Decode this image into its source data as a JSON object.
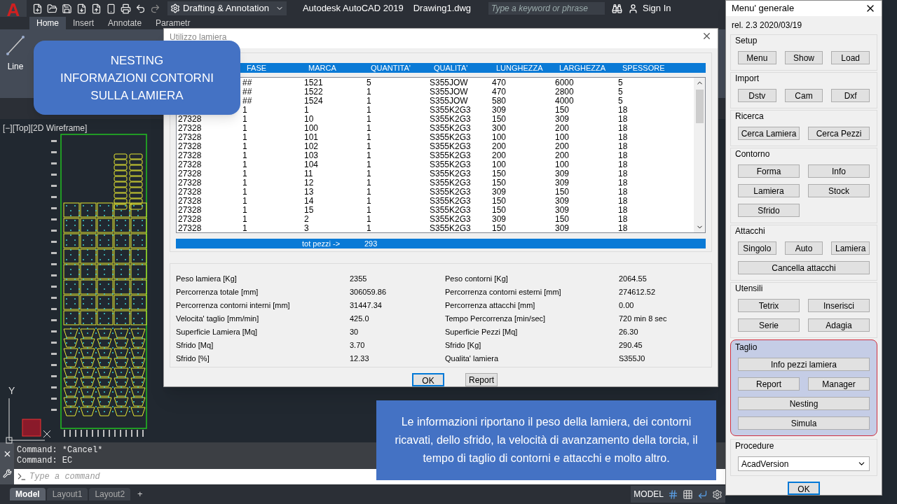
{
  "app": {
    "logo": "A",
    "workspace": "Drafting & Annotation",
    "title": "Autodesk AutoCAD 2019",
    "file": "Drawing1.dwg",
    "search": {
      "placeholder": "Type a keyword or phrase"
    },
    "sign_in": "Sign In"
  },
  "ribbon_tabs": [
    {
      "label": "Home",
      "selected": true
    },
    {
      "label": "Insert",
      "selected": false
    },
    {
      "label": "Annotate",
      "selected": false
    },
    {
      "label": "Parametr",
      "selected": false
    }
  ],
  "ribbon_tool": "Line",
  "viewport_label": "[−][Top][2D Wireframe]",
  "ucs_label": "Y",
  "callout_top": [
    "NESTING",
    "INFORMAZIONI CONTORNI",
    "SULLA LAMIERA"
  ],
  "dialog": {
    "title": "Utilizzo lamiera",
    "columns": [
      "",
      "FASE",
      "MARCA",
      "QUANTITA'",
      "QUALITA'",
      "LUNGHEZZA",
      "LARGHEZZA",
      "SPESSORE"
    ],
    "rows": [
      [
        "",
        "##",
        "1521",
        "5",
        "S355JOW",
        "470",
        "6000",
        "5"
      ],
      [
        "",
        "##",
        "1522",
        "1",
        "S355JOW",
        "470",
        "2800",
        "5"
      ],
      [
        "",
        "##",
        "1524",
        "1",
        "S355JOW",
        "580",
        "4000",
        "5"
      ],
      [
        "",
        "1",
        "1",
        "1",
        "S355K2G3",
        "309",
        "150",
        "18"
      ],
      [
        "27328",
        "1",
        "10",
        "1",
        "S355K2G3",
        "150",
        "309",
        "18"
      ],
      [
        "27328",
        "1",
        "100",
        "1",
        "S355K2G3",
        "300",
        "200",
        "18"
      ],
      [
        "27328",
        "1",
        "101",
        "1",
        "S355K2G3",
        "100",
        "100",
        "18"
      ],
      [
        "27328",
        "1",
        "102",
        "1",
        "S355K2G3",
        "200",
        "200",
        "18"
      ],
      [
        "27328",
        "1",
        "103",
        "1",
        "S355K2G3",
        "200",
        "200",
        "18"
      ],
      [
        "27328",
        "1",
        "104",
        "1",
        "S355K2G3",
        "100",
        "100",
        "18"
      ],
      [
        "27328",
        "1",
        "11",
        "1",
        "S355K2G3",
        "150",
        "309",
        "18"
      ],
      [
        "27328",
        "1",
        "12",
        "1",
        "S355K2G3",
        "150",
        "309",
        "18"
      ],
      [
        "27328",
        "1",
        "13",
        "1",
        "S355K2G3",
        "309",
        "150",
        "18"
      ],
      [
        "27328",
        "1",
        "14",
        "1",
        "S355K2G3",
        "150",
        "309",
        "18"
      ],
      [
        "27328",
        "1",
        "15",
        "1",
        "S355K2G3",
        "150",
        "309",
        "18"
      ],
      [
        "27328",
        "1",
        "2",
        "1",
        "S355K2G3",
        "309",
        "150",
        "18"
      ],
      [
        "27328",
        "1",
        "3",
        "1",
        "S355K2G3",
        "150",
        "309",
        "18"
      ]
    ],
    "total_label": "tot pezzi ->",
    "total_value": "293",
    "stats": [
      {
        "label": "Peso lamiera [Kg]",
        "value": "2355",
        "label2": "Peso contorni [Kg]",
        "value2": "2064.55"
      },
      {
        "label": "Percorrenza totale [mm]",
        "value": "306059.86",
        "label2": "Percorrenza contorni esterni [mm]",
        "value2": "274612.52"
      },
      {
        "label": "Percorrenza contorni interni [mm]",
        "value": "31447.34",
        "label2": "Percorrenza attacchi [mm]",
        "value2": "0.00"
      },
      {
        "label": "Velocita' taglio [mm/min]",
        "value": "425.0",
        "label2": "Tempo Percorrenza [min/sec]",
        "value2": "720 min 8 sec"
      },
      {
        "label": "Superficie Lamiera [Mq]",
        "value": "30",
        "label2": "Superficie Pezzi [Mq]",
        "value2": "26.30"
      },
      {
        "label": "Sfrido [Mq]",
        "value": "3.70",
        "label2": "Sfrido [Kg]",
        "value2": "290.45"
      },
      {
        "label": "Sfrido [%]",
        "value": "12.33",
        "label2": "Qualita' lamiera",
        "value2": "S355J0"
      }
    ],
    "buttons": [
      {
        "label": "OK",
        "default": true
      },
      {
        "label": "Report",
        "default": false
      }
    ]
  },
  "menu": {
    "title": "Menu' generale",
    "version": "rel. 2.3 2020/03/19",
    "groups": [
      {
        "title": "Setup",
        "highlighted": false,
        "buttons": [
          {
            "label": "Menu",
            "kind": "third"
          },
          {
            "label": "Show",
            "kind": "third"
          },
          {
            "label": "Load",
            "kind": "third"
          }
        ]
      },
      {
        "title": "Import",
        "highlighted": false,
        "buttons": [
          {
            "label": "Dstv",
            "kind": "third"
          },
          {
            "label": "Cam",
            "kind": "third"
          },
          {
            "label": "Dxf",
            "kind": "third"
          }
        ]
      },
      {
        "title": "Ricerca",
        "highlighted": false,
        "buttons": [
          {
            "label": "Cerca Lamiera",
            "kind": "half"
          },
          {
            "label": "Cerca Pezzi",
            "kind": "half"
          }
        ]
      },
      {
        "title": "Contorno",
        "highlighted": false,
        "buttons": [
          {
            "label": "Forma",
            "kind": "half"
          },
          {
            "label": "Info",
            "kind": "half"
          },
          {
            "label": "Lamiera",
            "kind": "half"
          },
          {
            "label": "Stock",
            "kind": "half"
          },
          {
            "label": "Sfrido",
            "kind": "half"
          }
        ]
      },
      {
        "title": "Attacchi",
        "highlighted": false,
        "buttons": [
          {
            "label": "Singolo",
            "kind": "third"
          },
          {
            "label": "Auto",
            "kind": "third"
          },
          {
            "label": "Lamiera",
            "kind": "third"
          },
          {
            "label": "Cancella attacchi",
            "kind": "wide"
          }
        ]
      },
      {
        "title": "Utensili",
        "highlighted": false,
        "buttons": [
          {
            "label": "Tetrix",
            "kind": "half"
          },
          {
            "label": "Inserisci",
            "kind": "half"
          },
          {
            "label": "Serie",
            "kind": "half"
          },
          {
            "label": "Adagia",
            "kind": "half"
          }
        ]
      },
      {
        "title": "Taglio",
        "highlighted": true,
        "buttons": [
          {
            "label": "Info pezzi lamiera",
            "kind": "wide"
          },
          {
            "label": "Report",
            "kind": "half"
          },
          {
            "label": "Manager",
            "kind": "half"
          },
          {
            "label": "Nesting",
            "kind": "wide"
          },
          {
            "label": "Simula",
            "kind": "wide"
          }
        ]
      }
    ],
    "procedure": {
      "title": "Procedure",
      "value": "AcadVersion"
    },
    "ok": "OK"
  },
  "command_history": [
    "Command: *Cancel*",
    "Command: EC"
  ],
  "command": {
    "placeholder": "Type a command"
  },
  "layout_tabs": [
    {
      "label": "Model",
      "selected": true
    },
    {
      "label": "Layout1",
      "selected": false
    },
    {
      "label": "Layout2",
      "selected": false
    }
  ],
  "add_tab": "+",
  "status_model": "MODEL",
  "callout_bottom": "Le informazioni  riportano il peso della lamiera, dei contorni ricavati, dello sfrido, la velocità di avanzamento della torcia, il tempo di taglio di contorni e attacchi e molto altro."
}
